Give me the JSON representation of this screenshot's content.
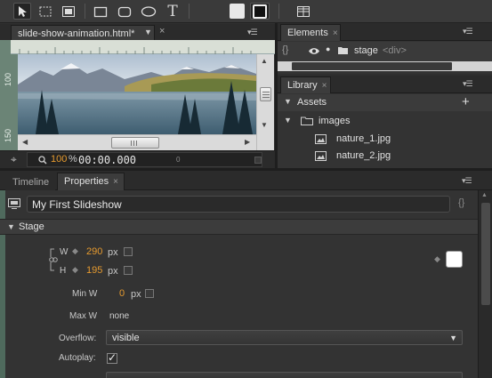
{
  "toolbar": {
    "tools": [
      "select-tool",
      "transform-tool",
      "crop-tool",
      "rectangle-tool",
      "rounded-rectangle-tool",
      "ellipse-tool",
      "text-tool",
      "fill-color",
      "stroke-color",
      "grid-tool"
    ],
    "text_tool_glyph": "T"
  },
  "stage": {
    "tab_label": "slide-show-animation.html*",
    "ruler_marks": [
      "100",
      "150"
    ],
    "zoom": "100",
    "zoom_unit": "%",
    "time": "00:00.000",
    "time_marker": "0"
  },
  "elements_panel": {
    "tab_label": "Elements",
    "item_label": "stage",
    "item_tag": "<div>"
  },
  "library_panel": {
    "tab_label": "Library",
    "section_label": "Assets",
    "folder_label": "images",
    "files": [
      "nature_1.jpg",
      "nature_2.jpg"
    ]
  },
  "bottom_tabs": {
    "timeline": "Timeline",
    "properties": "Properties"
  },
  "properties": {
    "title_value": "My First Slideshow",
    "section": "Stage",
    "w_label": "W",
    "w_value": "290",
    "h_label": "H",
    "h_value": "195",
    "unit": "px",
    "min_w_label": "Min W",
    "min_w_value": "0",
    "max_w_label": "Max W",
    "max_w_value": "none",
    "overflow_label": "Overflow:",
    "overflow_value": "visible",
    "autoplay_label": "Autoplay:",
    "autoplay_checked": true,
    "checkmark": "✓",
    "bg_color": "#ffffff"
  },
  "colors": {
    "accent_orange": "#e59a2f",
    "panel_bg": "#333333"
  }
}
